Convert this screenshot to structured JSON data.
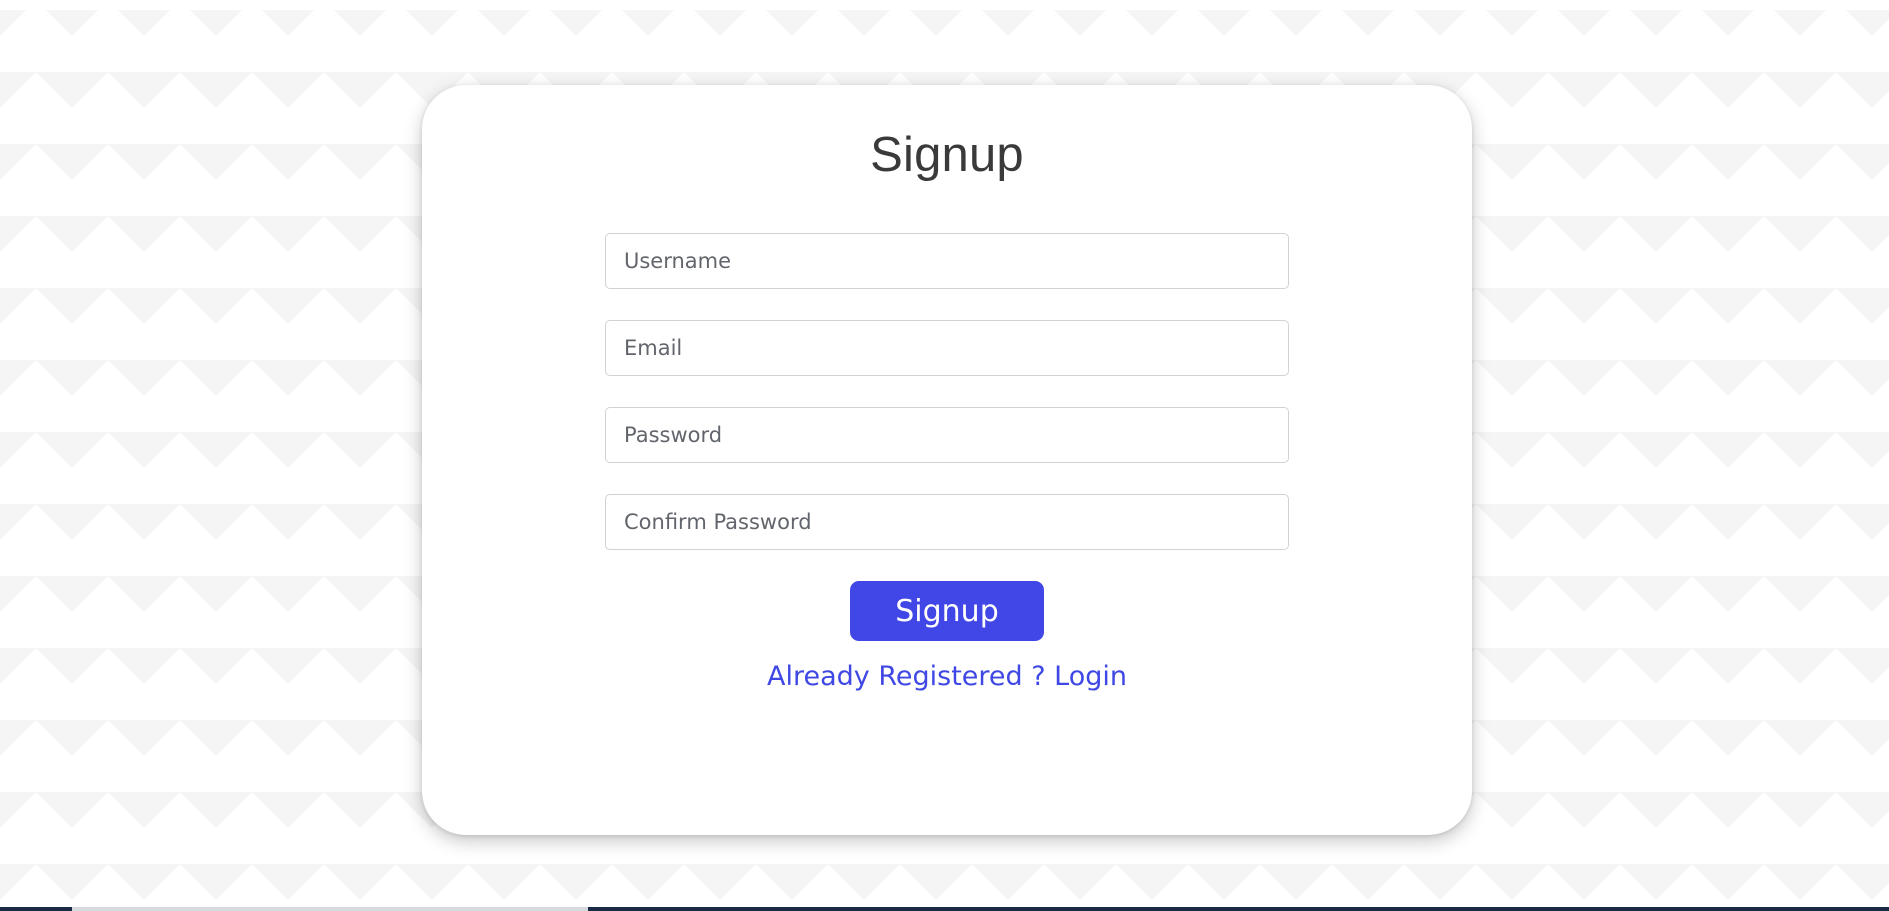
{
  "form": {
    "title": "Signup",
    "fields": [
      {
        "placeholder": "Username",
        "value": ""
      },
      {
        "placeholder": "Email",
        "value": ""
      },
      {
        "placeholder": "Password",
        "value": ""
      },
      {
        "placeholder": "Confirm Password",
        "value": ""
      }
    ],
    "submit_label": "Signup",
    "login_link_text": "Already Registered ? Login"
  },
  "colors": {
    "accent": "#4147e6",
    "link": "#3f48e4",
    "title": "#3a3a3a"
  }
}
